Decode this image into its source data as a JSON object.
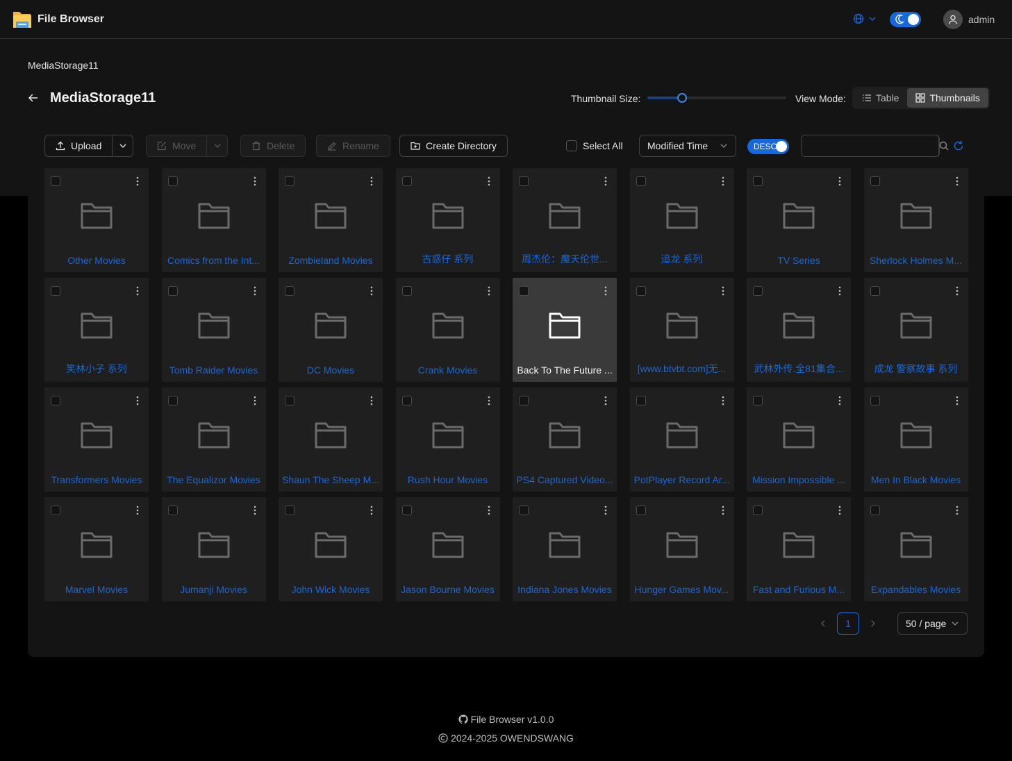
{
  "app": {
    "title": "File Browser"
  },
  "header": {
    "username": "admin"
  },
  "breadcrumb": "MediaStorage11",
  "page_title": "MediaStorage11",
  "view": {
    "thumbnail_size_label": "Thumbnail Size:",
    "thumbnail_size_fraction": 0.25,
    "view_mode_label": "View Mode:",
    "modes": [
      "Table",
      "Thumbnails"
    ],
    "active_mode": "Thumbnails"
  },
  "toolbar": {
    "upload": "Upload",
    "move": "Move",
    "delete": "Delete",
    "rename": "Rename",
    "create_directory": "Create Directory",
    "select_all": "Select All",
    "sort_by": "Modified Time",
    "order": "DESC",
    "search_placeholder": ""
  },
  "items": [
    "Other Movies",
    "Comics from the Int...",
    "Zombieland Movies",
    "古惑仔 系列",
    "周杰伦：魔天伦世...",
    "追龙 系列",
    "TV Series",
    "Sherlock Holmes M...",
    "笑林小子 系列",
    "Tomb Raider Movies",
    "DC Movies",
    "Crank Movies",
    "Back To The Future ...",
    "[www.btvbt.com]无...",
    "武林外传.全81集合...",
    "成龙 警察故事 系列",
    "Transformers Movies",
    "The Equalizor Movies",
    "Shaun The Sheep M...",
    "Rush Hour Movies",
    "PS4 Captured Video...",
    "PotPlayer Record Ar...",
    "Mission Impossible ...",
    "Men In Black Movies",
    "Marvel Movies",
    "Jumanji Movies",
    "John Wick Movies",
    "Jason Bourne Movies",
    "Indiana Jones Movies",
    "Hunger Games Mov...",
    "Fast and Furious M...",
    "Expandables Movies"
  ],
  "hovered_item_index": 12,
  "pagination": {
    "current": "1",
    "page_size": "50 / page"
  },
  "footer": {
    "version": "File Browser v1.0.0",
    "copyright": "2024-2025 OWENDSWANG"
  },
  "colors": {
    "accent": "#1668dc",
    "background": "#000000",
    "panel": "#141414",
    "card": "#1f1f1f",
    "card_hover": "#3a3a3a"
  }
}
